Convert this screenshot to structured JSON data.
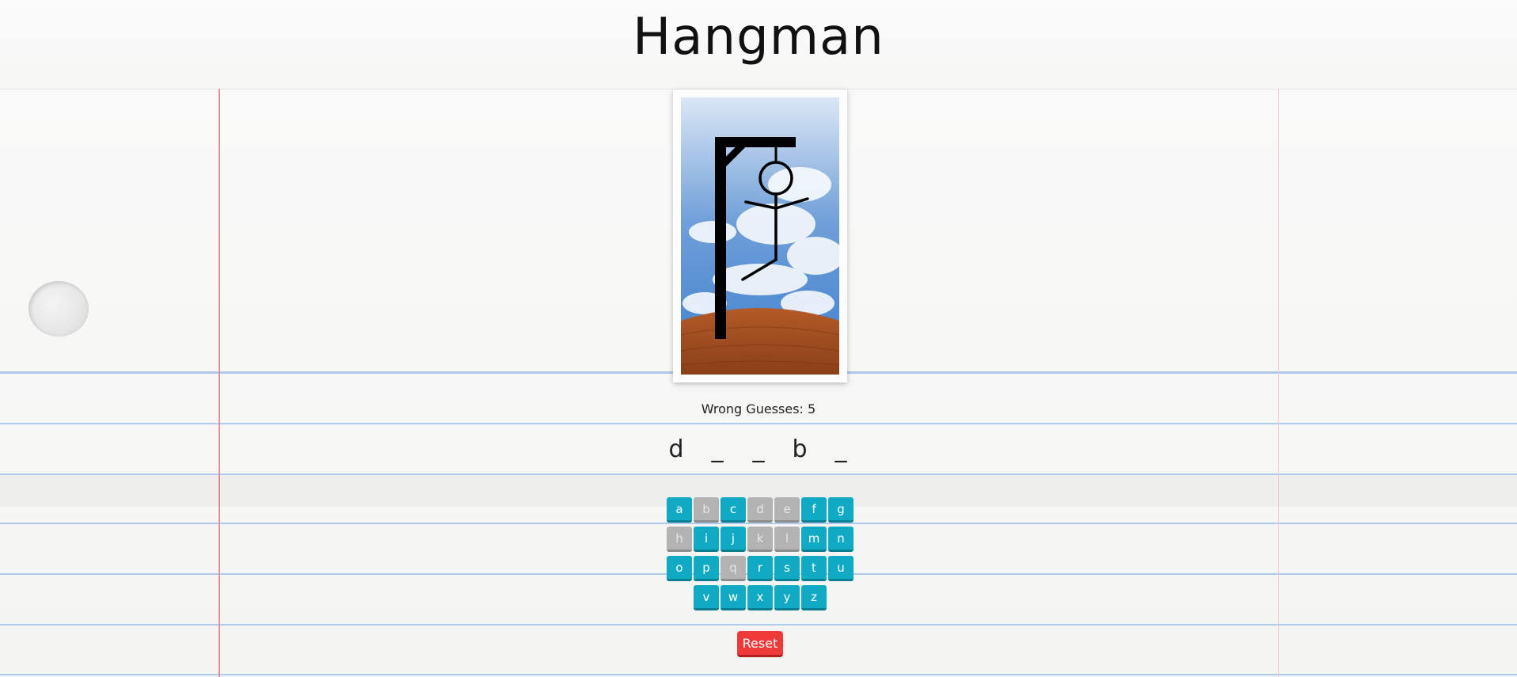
{
  "title": "Hangman",
  "status": {
    "wrong_guesses_label": "Wrong Guesses: 5"
  },
  "word": {
    "slots": [
      "d",
      "_",
      "_",
      "b",
      "_"
    ]
  },
  "keyboard": {
    "rows": [
      [
        {
          "letter": "a",
          "used": false
        },
        {
          "letter": "b",
          "used": true
        },
        {
          "letter": "c",
          "used": false
        },
        {
          "letter": "d",
          "used": true
        },
        {
          "letter": "e",
          "used": true
        },
        {
          "letter": "f",
          "used": false
        },
        {
          "letter": "g",
          "used": false
        }
      ],
      [
        {
          "letter": "h",
          "used": true
        },
        {
          "letter": "i",
          "used": false
        },
        {
          "letter": "j",
          "used": false
        },
        {
          "letter": "k",
          "used": true
        },
        {
          "letter": "l",
          "used": true
        },
        {
          "letter": "m",
          "used": false
        },
        {
          "letter": "n",
          "used": false
        }
      ],
      [
        {
          "letter": "o",
          "used": false
        },
        {
          "letter": "p",
          "used": false
        },
        {
          "letter": "q",
          "used": true
        },
        {
          "letter": "r",
          "used": false
        },
        {
          "letter": "s",
          "used": false
        },
        {
          "letter": "t",
          "used": false
        },
        {
          "letter": "u",
          "used": false
        }
      ],
      [
        {
          "letter": "v",
          "used": false
        },
        {
          "letter": "w",
          "used": false
        },
        {
          "letter": "x",
          "used": false
        },
        {
          "letter": "y",
          "used": false
        },
        {
          "letter": "z",
          "used": false
        }
      ]
    ]
  },
  "reset_label": "Reset",
  "hangman_parts_drawn": [
    "head",
    "body",
    "left-arm",
    "right-arm",
    "left-leg"
  ],
  "colors": {
    "key_active": "#10aac4",
    "key_used": "#b3b3b3",
    "reset": "#f03a3a"
  }
}
